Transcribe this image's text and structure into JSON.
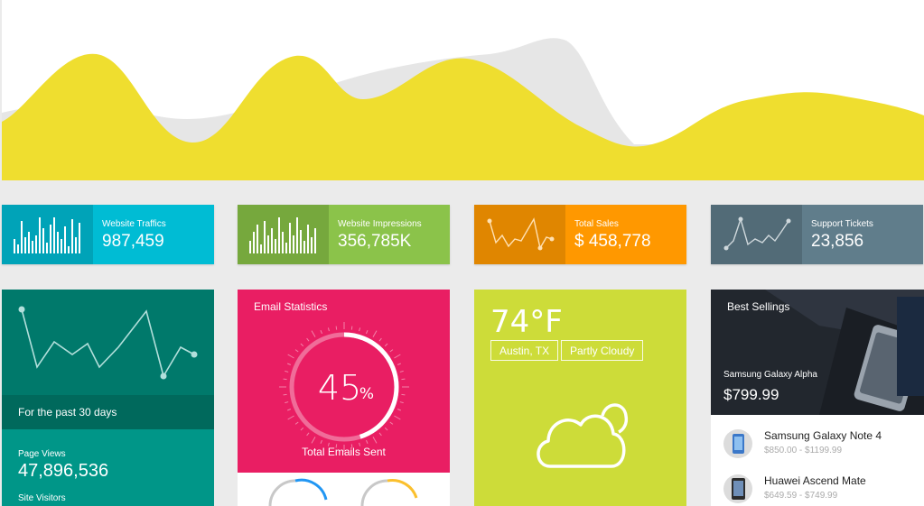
{
  "colors": {
    "yellow": "#efde2f",
    "grey_wave": "#e6e6e6",
    "cyan": "#00bcd4",
    "green": "#8bc34a",
    "orange": "#ff9800",
    "slate": "#607d8b",
    "teal": "#009688",
    "pink": "#e91e63",
    "lime": "#cddc39"
  },
  "stats": [
    {
      "label": "Website Traffics",
      "value": "987,459",
      "chart": "bars",
      "icon": "bar-sparkline"
    },
    {
      "label": "Website Impressions",
      "value": "356,785K",
      "chart": "bars",
      "icon": "bar-sparkline"
    },
    {
      "label": "Total Sales",
      "value": "$ 458,778",
      "chart": "line",
      "icon": "line-sparkline"
    },
    {
      "label": "Support Tickets",
      "value": "23,856",
      "chart": "line",
      "icon": "line-sparkline"
    }
  ],
  "traffic": {
    "caption": "For the past 30 days",
    "page_views_label": "Page Views",
    "page_views_value": "47,896,536",
    "site_visitors_label": "Site Visitors"
  },
  "email": {
    "title": "Email Statistics",
    "percent_number": "45",
    "percent_sign": "%",
    "percent_value": 0.45,
    "subtitle": "Total Emails Sent"
  },
  "weather": {
    "temperature": "74°F",
    "location": "Austin, TX",
    "condition": "Partly Cloudy",
    "icon": "cloud-icon"
  },
  "best_sellings": {
    "title": "Best Sellings",
    "featured_name": "Samsung Galaxy Alpha",
    "featured_price": "$799.99",
    "items": [
      {
        "name": "Samsung Galaxy Note 4",
        "price": "$850.00 - $1199.99"
      },
      {
        "name": "Huawei Ascend Mate",
        "price": "$649.59 - $749.99"
      }
    ]
  }
}
